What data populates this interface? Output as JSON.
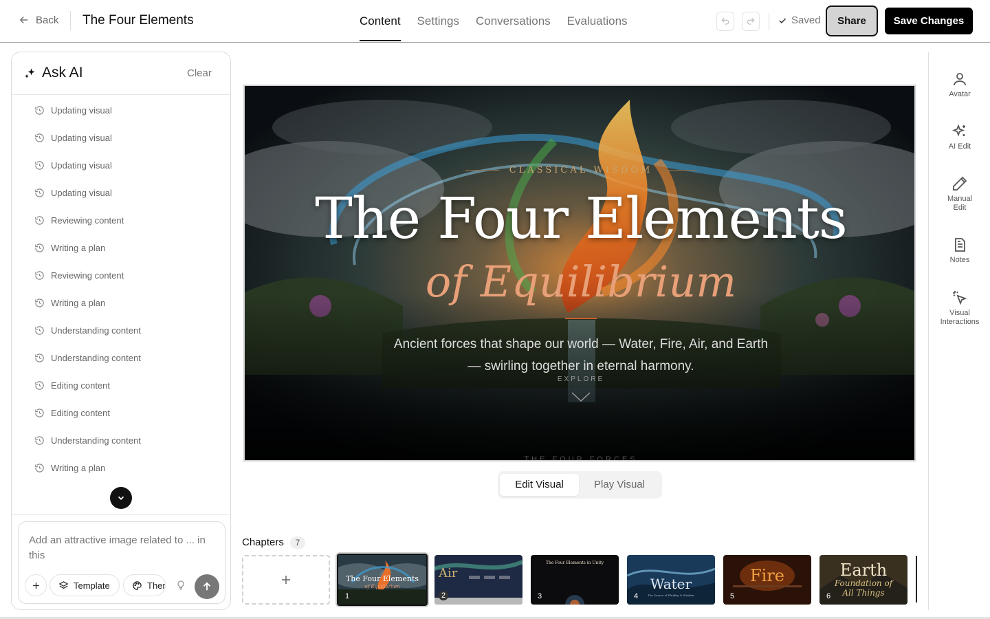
{
  "header": {
    "back_label": "Back",
    "title": "The Four Elements",
    "tabs": [
      {
        "label": "Content",
        "active": true
      },
      {
        "label": "Settings",
        "active": false
      },
      {
        "label": "Conversations",
        "active": false
      },
      {
        "label": "Evaluations",
        "active": false
      }
    ],
    "saved_label": "Saved",
    "share_label": "Share",
    "save_changes_label": "Save Changes"
  },
  "ask_ai": {
    "title": "Ask AI",
    "clear_label": "Clear",
    "steps": [
      "Updating visual",
      "Updating visual",
      "Updating visual",
      "Updating visual",
      "Reviewing content",
      "Writing a plan",
      "Reviewing content",
      "Writing a plan",
      "Understanding content",
      "Understanding content",
      "Editing content",
      "Editing content",
      "Understanding content",
      "Writing a plan"
    ],
    "composer_text": "Add an attractive image related to ... in this",
    "template_label": "Template",
    "theme_label": "Theme"
  },
  "visual": {
    "eyebrow": "CLASSICAL WISDOM",
    "title": "The Four Elements",
    "subtitle": "of Equilibrium",
    "description": "Ancient forces that shape our world — Water, Fire, Air, and Earth — swirling together in eternal harmony.",
    "explore_label": "EXPLORE",
    "next_section": "THE FOUR FORCES"
  },
  "toggle": {
    "edit_label": "Edit Visual",
    "play_label": "Play Visual",
    "active": "edit"
  },
  "chapters": {
    "label": "Chapters",
    "count": "7",
    "items": [
      {
        "number": "1",
        "title": "The Four Elements",
        "subtitle": "of Equilibrium",
        "selected": true
      },
      {
        "number": "2",
        "title": "Air",
        "subtitle": "",
        "selected": false
      },
      {
        "number": "3",
        "title": "The Four Elements in Unity",
        "subtitle": "",
        "selected": false
      },
      {
        "number": "4",
        "title": "Water",
        "subtitle": "The Source of Fluidity & Wisdom",
        "selected": false
      },
      {
        "number": "5",
        "title": "Fire",
        "subtitle": "",
        "selected": false
      },
      {
        "number": "6",
        "title": "Earth",
        "subtitle": "Foundation of All Things",
        "selected": false
      }
    ]
  },
  "right_rail": {
    "items": [
      {
        "label": "Avatar",
        "icon": "user-icon"
      },
      {
        "label": "AI Edit",
        "icon": "sparkles-icon"
      },
      {
        "label": "Manual Edit",
        "icon": "pencil-icon"
      },
      {
        "label": "Notes",
        "icon": "notes-icon"
      },
      {
        "label": "Visual Interactions",
        "icon": "cursor-click-icon"
      }
    ]
  },
  "colors": {
    "accent": "#111111",
    "fire": "#e8702a",
    "water": "#3a9ed8",
    "earth": "#5a8a3a",
    "subtitle": "#e8a078"
  }
}
